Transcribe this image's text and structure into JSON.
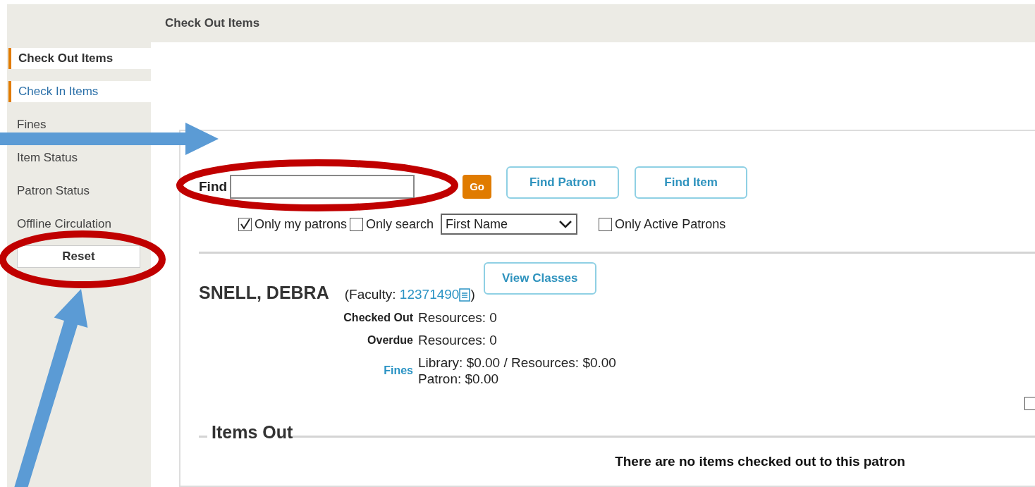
{
  "header": {
    "title": "Check Out Items"
  },
  "sidebar": {
    "items": [
      {
        "label": "Check Out Items",
        "selected": true,
        "kind": "tab"
      },
      {
        "label": "Check In Items",
        "selected": false,
        "kind": "tab"
      },
      {
        "label": "Fines",
        "selected": false,
        "kind": "link"
      },
      {
        "label": "Item Status",
        "selected": false,
        "kind": "link"
      },
      {
        "label": "Patron Status",
        "selected": false,
        "kind": "link"
      },
      {
        "label": "Offline Circulation",
        "selected": false,
        "kind": "link"
      }
    ],
    "reset_button": "Reset"
  },
  "search": {
    "label": "Find",
    "go_button": "Go",
    "buttons": [
      "Find Patron",
      "Find Item"
    ],
    "options": [
      {
        "kind": "checkbox",
        "label": "Only my patrons",
        "checked": true
      },
      {
        "kind": "checkbox",
        "label": "Only search",
        "checked": false
      },
      {
        "kind": "select",
        "value": "First Name"
      },
      {
        "kind": "checkbox",
        "label": "Only Active Patrons",
        "checked": false
      }
    ]
  },
  "patron": {
    "name": "SNELL, DEBRA",
    "type_prefix": "(Faculty: ",
    "id": "12371490",
    "type_suffix": ")",
    "view_classes_button": "View Classes",
    "stats": [
      {
        "label": "Checked Out",
        "kind": "text",
        "lines": [
          "Resources: 0"
        ]
      },
      {
        "label": "Overdue",
        "kind": "text",
        "lines": [
          "Resources: 0"
        ]
      },
      {
        "label": "Fines",
        "kind": "link",
        "lines": [
          "Library: $0.00 / Resources: $0.00",
          "Patron: $0.00"
        ]
      }
    ],
    "edge_checkbox": {
      "checked": false
    }
  },
  "items_out": {
    "title": "Items Out",
    "message": "There are no items checked out to this patron"
  }
}
